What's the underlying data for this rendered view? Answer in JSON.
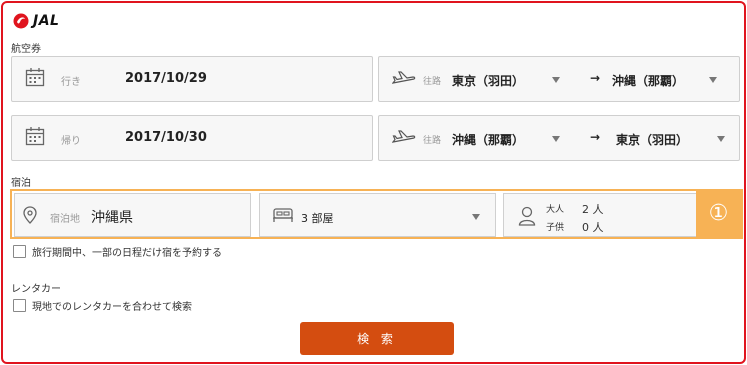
{
  "brand": {
    "name": "JAL",
    "color": "#e0141e"
  },
  "flights": {
    "section_label": "航空券",
    "outbound": {
      "date_label": "行き",
      "date": "2017/10/29",
      "route_label": "往路",
      "from": "東京（羽田）",
      "to": "沖縄（那覇）",
      "arrow": "→"
    },
    "return": {
      "date_label": "帰り",
      "date": "2017/10/30",
      "route_label": "往路",
      "from": "沖縄（那覇）",
      "to": "東京（羽田）",
      "arrow": "→"
    }
  },
  "hotel": {
    "section_label": "宿泊",
    "location_label": "宿泊地",
    "location": "沖縄県",
    "rooms": "3 部屋",
    "adults_label": "大人",
    "adults": "2 人",
    "children_label": "子供",
    "children": "0 人",
    "room_index": "①",
    "partial_stay_label": "旅行期間中、一部の日程だけ宿を予約する"
  },
  "rental": {
    "section_label": "レンタカー",
    "checkbox_label": "現地でのレンタカーを合わせて検索"
  },
  "search_button": "検 索",
  "colors": {
    "accent": "#f7b255",
    "button": "#d44d10",
    "frame": "#e0141e"
  }
}
